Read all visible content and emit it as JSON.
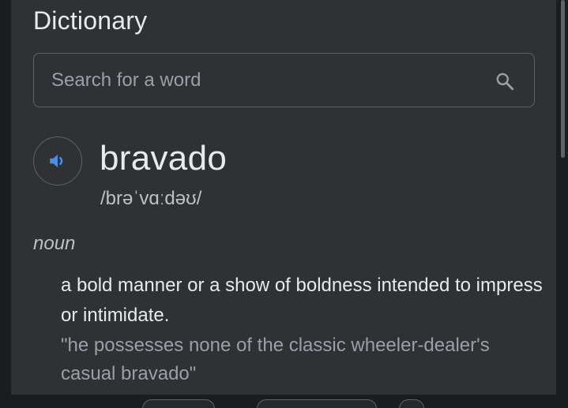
{
  "header": {
    "title": "Dictionary"
  },
  "search": {
    "placeholder": "Search for a word"
  },
  "entry": {
    "word": "bravado",
    "phonetic": "/brəˈvɑːdəʊ/",
    "part_of_speech": "noun",
    "definition": "a bold manner or a show of boldness intended to impress or intimidate.",
    "example": "\"he possesses none of the classic wheeler-dealer's casual bravado\""
  },
  "icons": {
    "search": "search-icon",
    "pronounce": "speaker-icon"
  },
  "colors": {
    "accent": "#4a8fe7",
    "card": "#303134",
    "text": "#e8eaed",
    "muted": "#9aa0a6"
  }
}
